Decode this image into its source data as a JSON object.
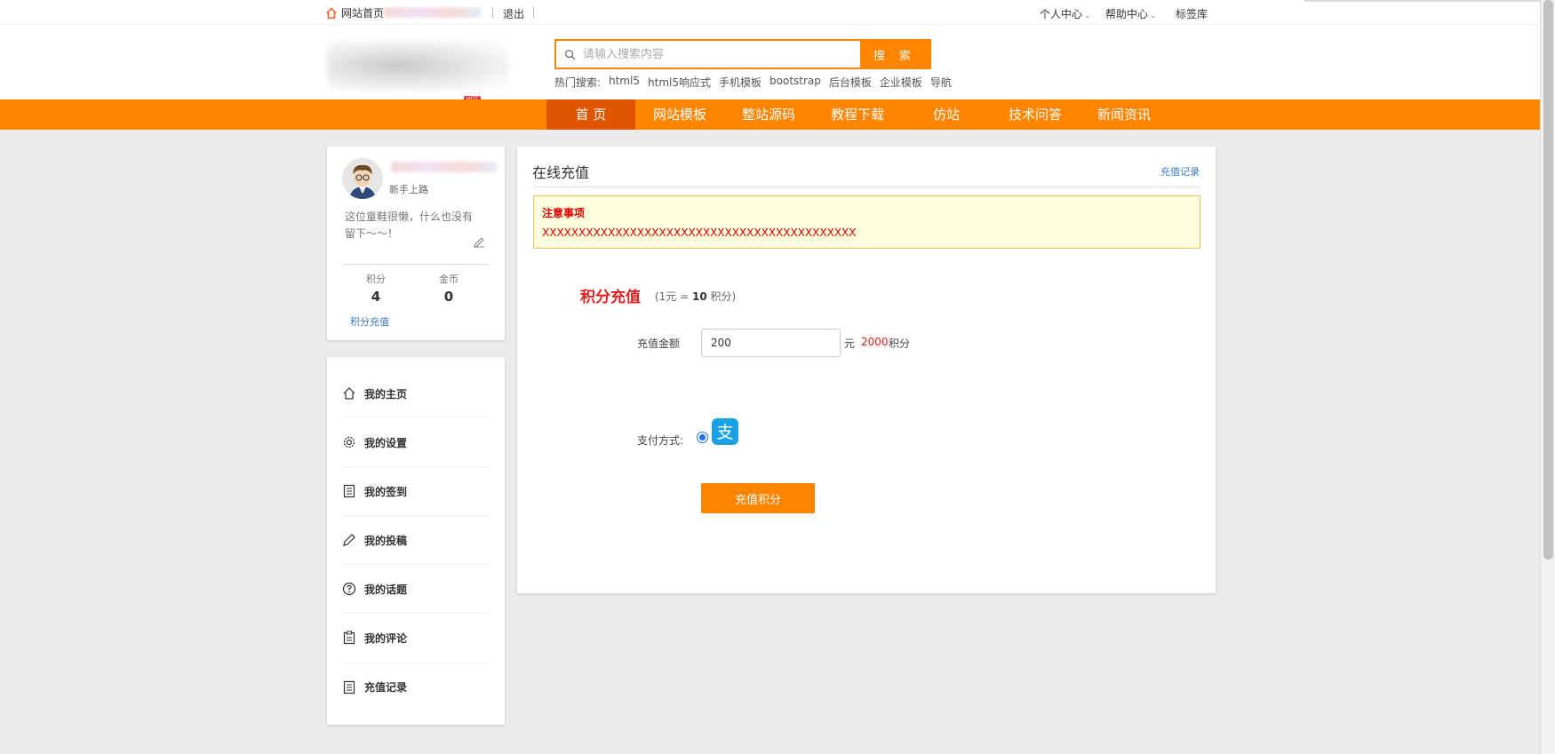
{
  "topbar": {
    "home_label": "网站首页",
    "logout_label": "退出",
    "personal_center": "个人中心",
    "help_center": "帮助中心",
    "tag_library": "标签库"
  },
  "header": {
    "hot_badge": "HOT",
    "search_placeholder": "请输入搜索内容",
    "search_button": "搜 索",
    "hot_search_label": "热门搜索:",
    "hot_search_terms": [
      "html5",
      "html5响应式",
      "手机模板",
      "bootstrap",
      "后台模板",
      "企业模板",
      "导航"
    ]
  },
  "nav": {
    "items": [
      "首 页",
      "网站模板",
      "整站源码",
      "教程下载",
      "仿站",
      "技术问答",
      "新闻资讯"
    ],
    "active_index": 0
  },
  "profile": {
    "rank": "新手上路",
    "bio": "这位童鞋很懒，什么也没有留下～～！",
    "points_label": "积分",
    "points_value": "4",
    "coins_label": "金币",
    "coins_value": "0",
    "recharge_link": "积分充值"
  },
  "menu": {
    "items": [
      {
        "label": "我的主页",
        "icon": "home-icon"
      },
      {
        "label": "我的设置",
        "icon": "gear-icon"
      },
      {
        "label": "我的签到",
        "icon": "document-icon"
      },
      {
        "label": "我的投稿",
        "icon": "pencil-icon"
      },
      {
        "label": "我的话题",
        "icon": "question-icon"
      },
      {
        "label": "我的评论",
        "icon": "clipboard-icon"
      },
      {
        "label": "充值记录",
        "icon": "document-icon"
      }
    ]
  },
  "main": {
    "title": "在线充值",
    "record_link": "充值记录",
    "notice_heading": "注意事项",
    "notice_text": "XXXXXXXXXXXXXXXXXXXXXXXXXXXXXXXXXXXXXXXXXXX",
    "section_title": "积分充值",
    "rate_prefix": "(1元 = ",
    "rate_value": "10",
    "rate_suffix": " 积分)",
    "amount_label": "充值金额",
    "amount_value": "200",
    "currency_unit": "元",
    "points_result": "2000",
    "points_unit": "积分",
    "payment_label": "支付方式:",
    "payment_method": "alipay",
    "submit_button": "充值积分"
  },
  "colors": {
    "accent": "#ff8400",
    "nav_active": "#e05500",
    "highlight_red": "#e02020",
    "link_blue": "#3a7bbf"
  }
}
